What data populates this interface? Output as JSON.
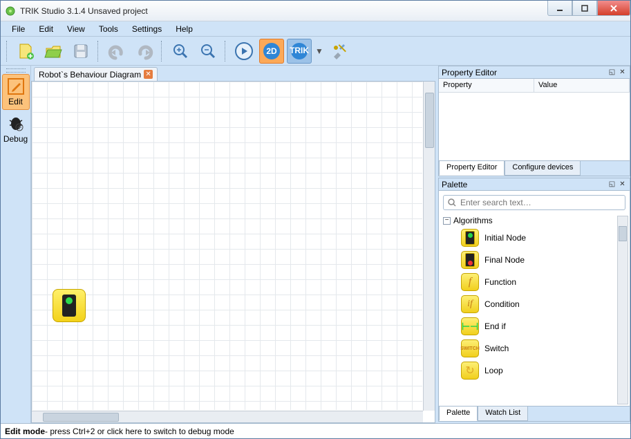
{
  "window": {
    "title": "TRIK Studio 3.1.4 Unsaved project"
  },
  "menu": {
    "items": [
      "File",
      "Edit",
      "View",
      "Tools",
      "Settings",
      "Help"
    ]
  },
  "toolbar": {
    "twoD": "2D"
  },
  "modes": {
    "edit": "Edit",
    "debug": "Debug"
  },
  "docTab": {
    "label": "Robot`s Behaviour Diagram"
  },
  "propertyEditor": {
    "title": "Property Editor",
    "col_property": "Property",
    "col_value": "Value",
    "tab_editor": "Property Editor",
    "tab_configure": "Configure devices"
  },
  "palette": {
    "title": "Palette",
    "search_placeholder": "Enter search text…",
    "group": "Algorithms",
    "items": [
      {
        "label": "Initial Node"
      },
      {
        "label": "Final Node"
      },
      {
        "label": "Function"
      },
      {
        "label": "Condition"
      },
      {
        "label": "End if"
      },
      {
        "label": "Switch"
      },
      {
        "label": "Loop"
      }
    ],
    "tab_palette": "Palette",
    "tab_watch": "Watch List"
  },
  "status": {
    "mode": "Edit mode",
    "hint": " - press Ctrl+2 or click here to switch to debug mode"
  }
}
